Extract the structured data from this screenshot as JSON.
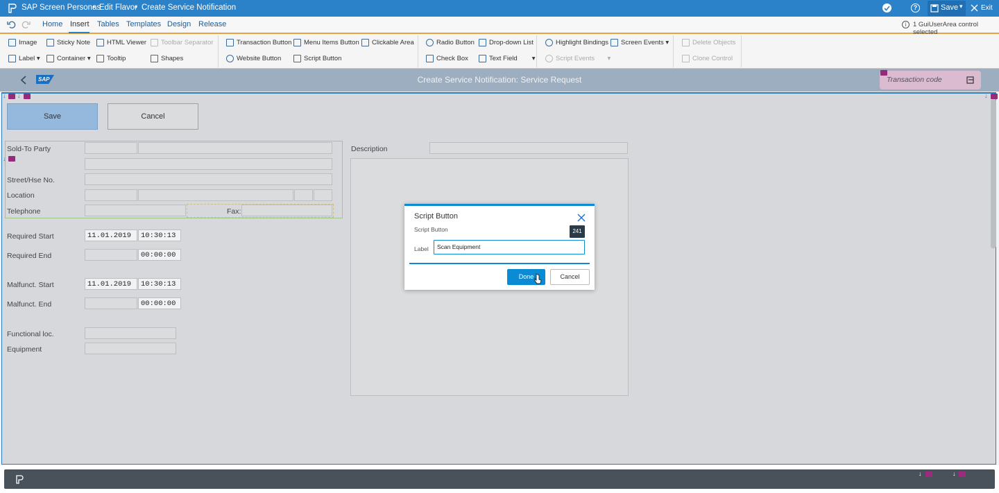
{
  "titlebar": {
    "app": "SAP Screen Personas",
    "sep1": "•",
    "mode": "Edit Flavor",
    "sep2": "•",
    "screen": "Create Service Notification",
    "save": "Save",
    "exit": "Exit"
  },
  "tabs": [
    "Home",
    "Insert",
    "Tables",
    "Templates",
    "Design",
    "Release"
  ],
  "active_tab": "Insert",
  "status_selection": "1 GuiUserArea control selected",
  "ribbon": {
    "image": "Image",
    "sticky_note": "Sticky Note",
    "html_viewer": "HTML Viewer",
    "toolbar_separator": "Toolbar Separator",
    "label": "Label",
    "container": "Container",
    "tooltip": "Tooltip",
    "shapes": "Shapes",
    "transaction_button": "Transaction Button",
    "menu_items_button": "Menu Items Button",
    "clickable_area": "Clickable Area",
    "website_button": "Website Button",
    "script_button": "Script Button",
    "radio_button": "Radio Button",
    "dropdown_list": "Drop-down List",
    "check_box": "Check Box",
    "text_field": "Text Field",
    "highlight_bindings": "Highlight Bindings",
    "screen_events": "Screen Events",
    "script_events": "Script Events",
    "delete_objects": "Delete Objects",
    "clone_control": "Clone Control"
  },
  "sapbar": {
    "logo": "SAP",
    "title": "Create Service Notification: Service Request",
    "tcode_placeholder": "Transaction code"
  },
  "form": {
    "save": "Save",
    "cancel": "Cancel",
    "sold_to_party": "Sold-To Party",
    "street": "Street/Hse No.",
    "location": "Location",
    "telephone": "Telephone",
    "fax": "Fax:",
    "description": "Description",
    "required_start": "Required Start",
    "required_start_date": "11.01.2019",
    "required_start_time": "10:30:13",
    "required_end": "Required End",
    "required_end_time": "00:00:00",
    "malfunct_start": "Malfunct. Start",
    "malfunct_start_date": "11.01.2019",
    "malfunct_start_time": "10:30:13",
    "malfunct_end": "Malfunct. End",
    "malfunct_end_time": "00:00:00",
    "functional_loc": "Functional loc.",
    "equipment": "Equipment"
  },
  "dialog": {
    "title": "Script Button",
    "subtitle": "Script Button",
    "label": "Label",
    "value": "Scan Equipment",
    "tooltip_count": "241",
    "done": "Done",
    "cancel": "Cancel"
  },
  "colors": {
    "titlebar": "#2c82c9",
    "accent": "#0a8bd4",
    "marker": "#9c2a7d",
    "tab_underline": "#e8a33c"
  }
}
